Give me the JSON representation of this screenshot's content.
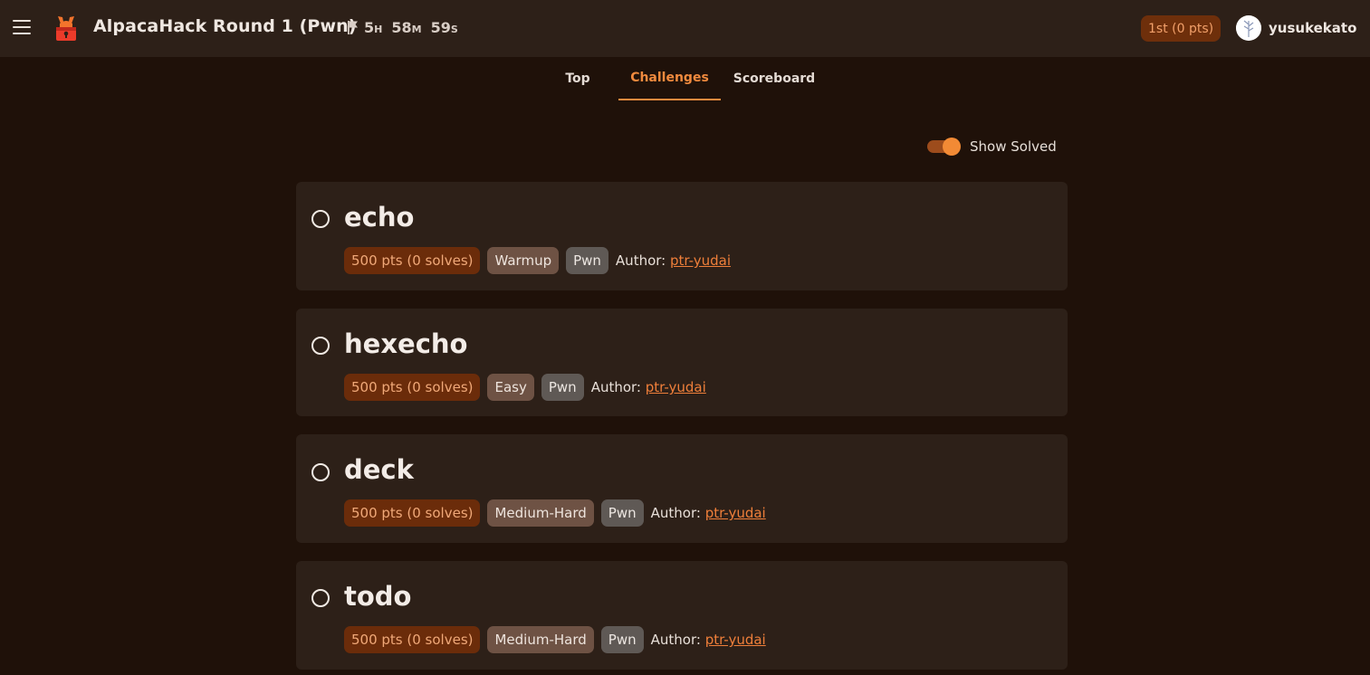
{
  "header": {
    "title": "AlpacaHack Round 1 (Pwn)",
    "timer": {
      "hours": "5",
      "hours_unit": "H",
      "minutes": "58",
      "minutes_unit": "M",
      "seconds": "59",
      "seconds_unit": "S"
    },
    "rank": "1st (0 pts)",
    "username": "yusukekato",
    "icons": {
      "menu": "hamburger-menu-icon",
      "logo": "alpaca-lock-logo",
      "timer": "flag-icon",
      "avatar": "user-avatar"
    }
  },
  "tabs": [
    {
      "label": "Top",
      "active": false
    },
    {
      "label": "Challenges",
      "active": true
    },
    {
      "label": "Scoreboard",
      "active": false
    }
  ],
  "filter": {
    "show_solved_label": "Show Solved",
    "show_solved": true
  },
  "challenges": [
    {
      "name": "echo",
      "points": "500 pts (0 solves)",
      "difficulty": "Warmup",
      "category": "Pwn",
      "author_label": "Author:",
      "author": "ptr-yudai"
    },
    {
      "name": "hexecho",
      "points": "500 pts (0 solves)",
      "difficulty": "Easy",
      "category": "Pwn",
      "author_label": "Author:",
      "author": "ptr-yudai"
    },
    {
      "name": "deck",
      "points": "500 pts (0 solves)",
      "difficulty": "Medium-Hard",
      "category": "Pwn",
      "author_label": "Author:",
      "author": "ptr-yudai"
    },
    {
      "name": "todo",
      "points": "500 pts (0 solves)",
      "difficulty": "Medium-Hard",
      "category": "Pwn",
      "author_label": "Author:",
      "author": "ptr-yudai"
    }
  ],
  "colors": {
    "background": "#1f1109",
    "surface": "#2d2018",
    "accent": "#f08a3e",
    "points_chip": "#6b2c0a",
    "difficulty_chip": "#6e5244",
    "category_chip": "#5f5955"
  }
}
